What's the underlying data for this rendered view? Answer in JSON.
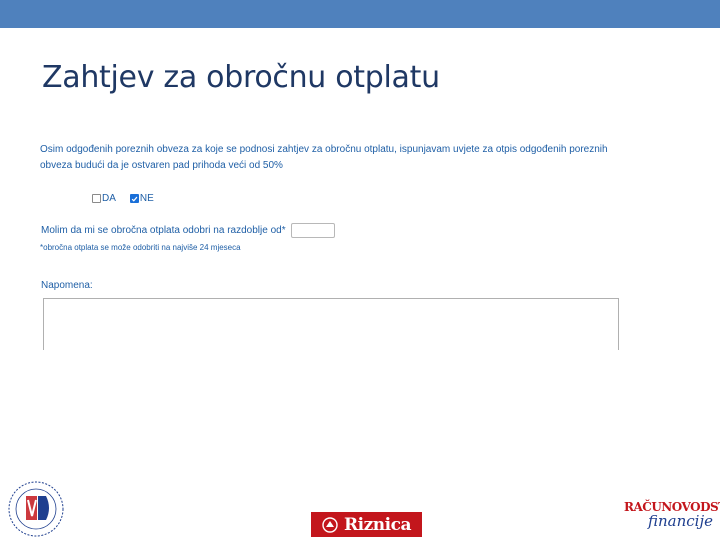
{
  "slide": {
    "title": "Zahtjev za obročnu otplatu"
  },
  "form": {
    "intro": "Osim odgođenih poreznih obveza za koje se podnosi zahtjev za obročnu otplatu, ispunjavam uvjete za otpis odgođenih poreznih obveza budući da je ostvaren pad prihoda veći od 50%",
    "option_da": {
      "label": "DA",
      "checked": false
    },
    "option_ne": {
      "label": "NE",
      "checked": true
    },
    "period_label": "Molim da mi se obročna otplata odobri na razdoblje od*",
    "period_value": "",
    "period_note": "*obročna otplata se može odobriti na najviše 24 mjeseca",
    "napomena_label": "Napomena:",
    "napomena_value": ""
  },
  "logos": {
    "middle_text": "Riznica",
    "right_top": "RAČUNOVODSTVO",
    "right_bottom": "financije",
    "brand_red": "#c3161c",
    "brand_blue": "#1f3f8f"
  },
  "colors": {
    "top_bar": "#4f81bd",
    "title": "#1f3864",
    "form_text": "#1f5fa6",
    "checkbox_checked": "#1a6fd8"
  }
}
